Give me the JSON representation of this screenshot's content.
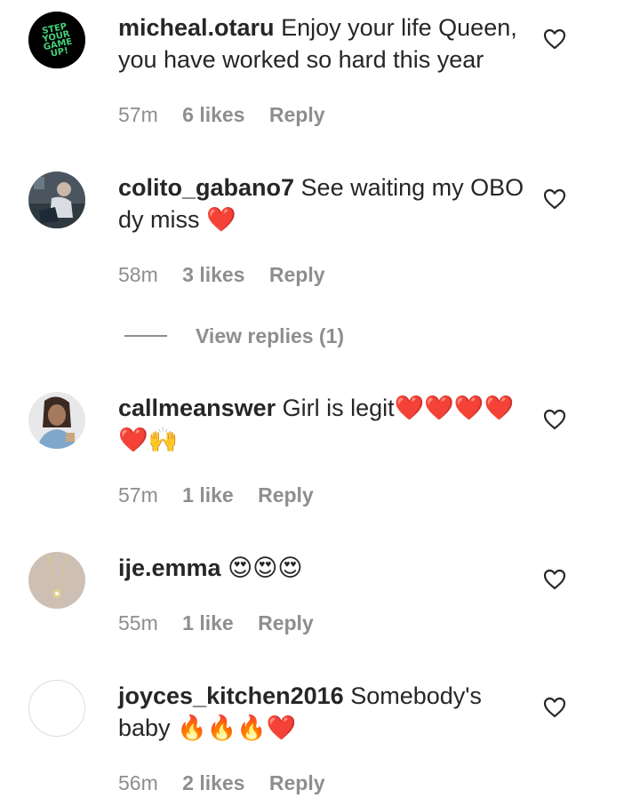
{
  "comments": [
    {
      "username": "micheal.otaru",
      "text": "Enjoy your life Queen, you have worked so hard this year",
      "time": "57m",
      "likes": "6 likes",
      "reply": "Reply",
      "avatar_logo_text": "STEP YOUR GAME UP!"
    },
    {
      "username": "colito_gabano7",
      "text": "See waiting my OBO dy miss ❤️",
      "time": "58m",
      "likes": "3 likes",
      "reply": "Reply"
    },
    {
      "username": "callmeanswer",
      "text": "Girl is legit❤️❤️❤️❤️❤️🙌",
      "time": "57m",
      "likes": "1 like",
      "reply": "Reply"
    },
    {
      "username": "ije.emma",
      "text": "😍😍😍",
      "time": "55m",
      "likes": "1 like",
      "reply": "Reply"
    },
    {
      "username": "joyces_kitchen2016",
      "text": "Somebody's baby 🔥🔥🔥❤️",
      "time": "56m",
      "likes": "2 likes",
      "reply": "Reply"
    }
  ],
  "view_replies": "View replies (1)",
  "colors": {
    "text": "#262626",
    "meta": "#8e8e8e",
    "logo_green": "#43d17a",
    "heart_red": "#e0212f"
  },
  "icons": {
    "like": "heart-outline-icon"
  }
}
